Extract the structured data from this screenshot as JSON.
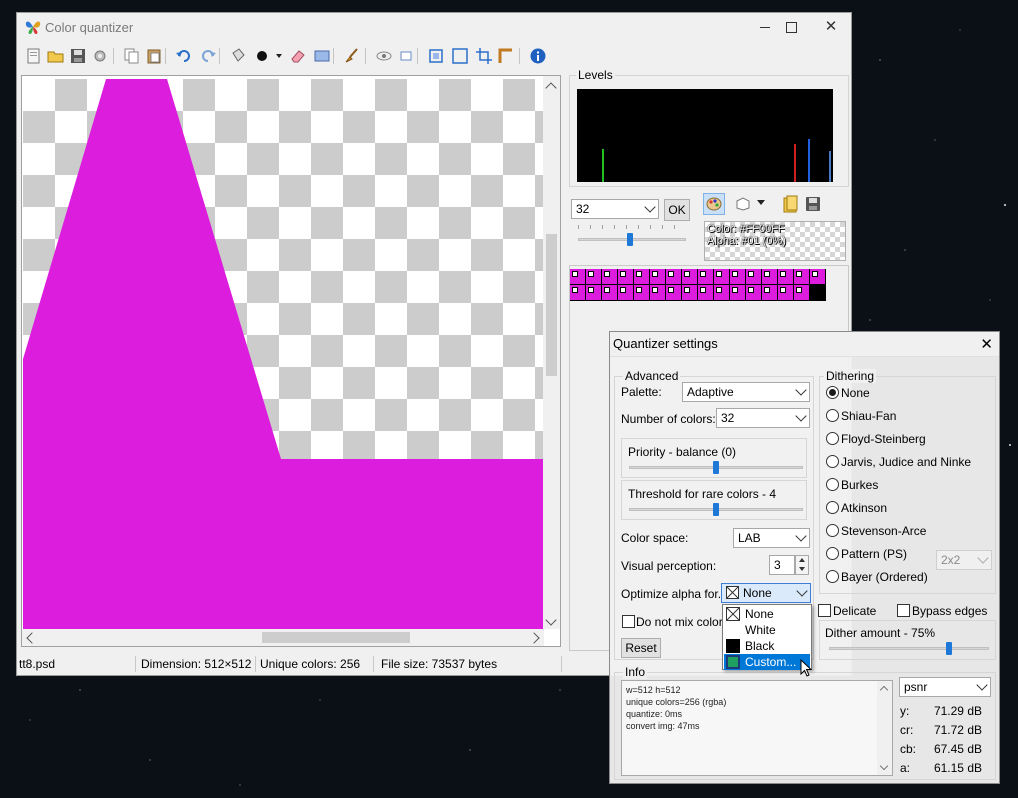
{
  "window": {
    "title": "Color quantizer"
  },
  "toolbar": {
    "icons": [
      "open-icon",
      "open-folder-icon",
      "save-icon",
      "settings-icon",
      "copy-icon",
      "paste-icon",
      "undo-icon",
      "redo-icon",
      "bucket-icon",
      "color-dot-icon",
      "dropdown-arrow-icon",
      "eraser-icon",
      "rectangle-icon",
      "brush-icon",
      "eye-icon",
      "small-preview-icon",
      "fit-icon",
      "actual-size-icon",
      "crop-icon",
      "ruler-icon",
      "info-icon"
    ]
  },
  "image": {
    "fill_color": "#DD1DDD"
  },
  "status": {
    "filename": "tt8.psd",
    "dimension": "Dimension: 512×512",
    "unique": "Unique colors: 256",
    "filesize": "File size: 73537 bytes"
  },
  "levels": {
    "label": "Levels"
  },
  "colors_combo": {
    "value": "32"
  },
  "ok_label": "OK",
  "color_info": {
    "color": "Color: #FF00FF",
    "alpha": "Alpha: #01 (0%)"
  },
  "palette": {
    "count": 32,
    "color": "#DD1DDD"
  },
  "dialog": {
    "title": "Quantizer settings",
    "advanced": "Advanced",
    "palette_label": "Palette:",
    "palette_value": "Adaptive",
    "num_colors_label": "Number of colors:",
    "num_colors_value": "32",
    "priority_label": "Priority - balance (0)",
    "priority_level": 0.5,
    "threshold_label": "Threshold for rare colors - 4",
    "threshold_level": 0.5,
    "color_space_label": "Color space:",
    "color_space_value": "LAB",
    "visual_label": "Visual perception:",
    "visual_value": "3",
    "optimize_label": "Optimize alpha for...",
    "optimize_value": "None",
    "no_mix_label": "Do not mix colors",
    "reset_label": "Reset",
    "dithering": "Dithering",
    "dither_options": [
      "None",
      "Shiau-Fan",
      "Floyd-Steinberg",
      "Jarvis, Judice and Ninke",
      "Burkes",
      "Atkinson",
      "Stevenson-Arce",
      "Pattern (PS)",
      "Bayer (Ordered)"
    ],
    "dither_selected": "None",
    "pattern_value": "2x2",
    "delicate_label": "Delicate",
    "bypass_label": "Bypass edges",
    "dither_amount_label": "Dither amount - 75%",
    "dither_amount": 0.75,
    "info": "Info",
    "info_lines": [
      "w=512 h=512",
      "unique colors=256 (rgba)",
      "quantize: 0ms",
      "convert img: 47ms"
    ],
    "metric_select": "psnr",
    "metrics": [
      {
        "k": "y:",
        "v": "71.29 dB"
      },
      {
        "k": "cr:",
        "v": "71.72 dB"
      },
      {
        "k": "cb:",
        "v": "67.45 dB"
      },
      {
        "k": "a:",
        "v": "61.15 dB"
      }
    ]
  },
  "dropdown": {
    "items": [
      "None",
      "White",
      "Black",
      "Custom..."
    ],
    "selected": "Custom..."
  }
}
